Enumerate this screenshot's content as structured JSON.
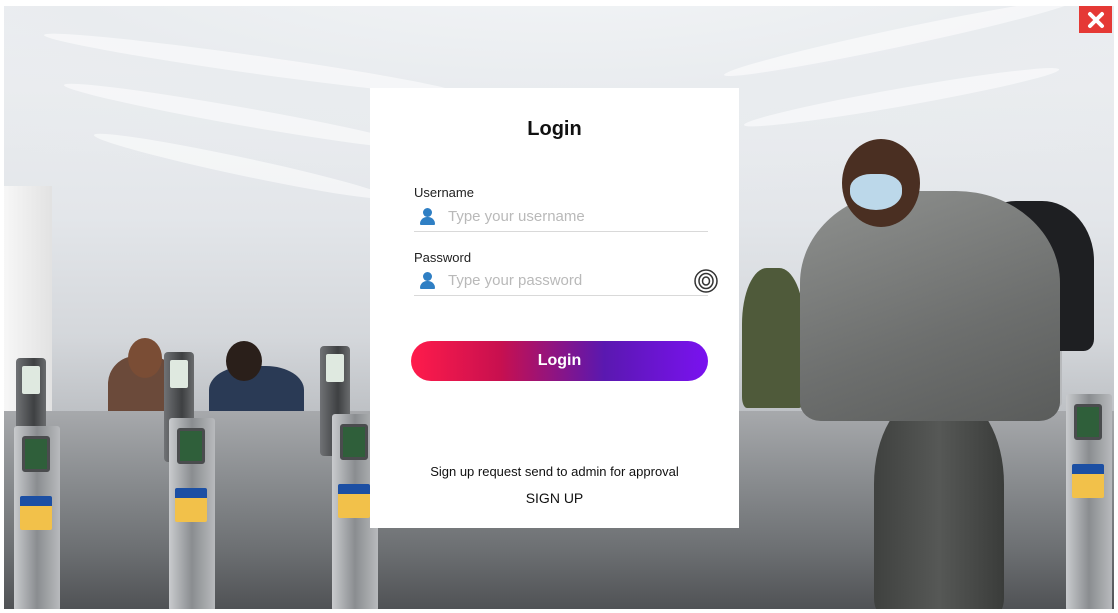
{
  "login": {
    "title": "Login",
    "username_label": "Username",
    "username_placeholder": "Type your username",
    "username_value": "",
    "password_label": "Password",
    "password_placeholder": "Type your password",
    "password_value": "",
    "login_button": "Login",
    "signup_note": "Sign up request send to admin for approval",
    "signup_link": "SIGN UP"
  },
  "icons": {
    "close": "close-icon",
    "user": "user-icon",
    "eye": "eye-icon"
  },
  "colors": {
    "close_button": "#e53935",
    "user_icon": "#2f7fc4",
    "button_gradient_start": "#ff1b4b",
    "button_gradient_end": "#7a12f0"
  }
}
